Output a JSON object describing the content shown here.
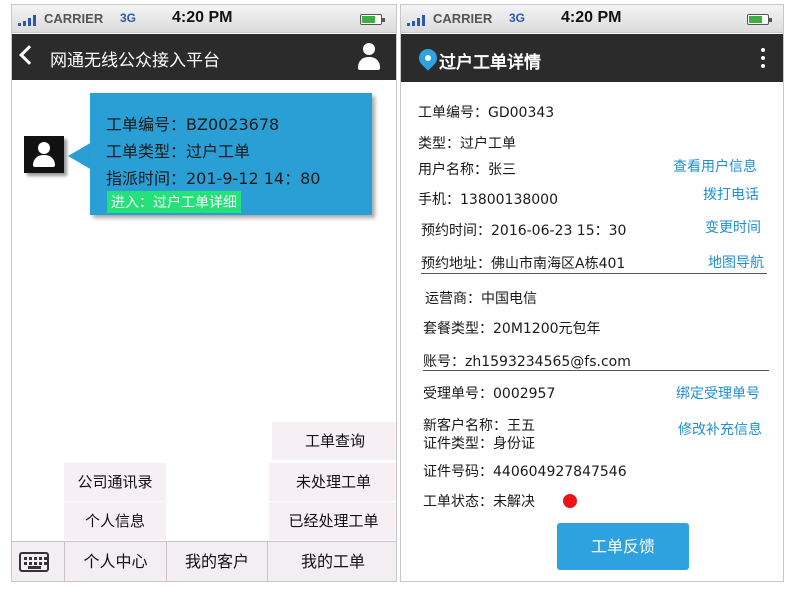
{
  "status_bar": {
    "carrier": "CARRIER",
    "network": "3G",
    "time": "4:20 PM"
  },
  "left": {
    "title": "网通无线公众接入平台",
    "bubble": {
      "order_no": "工单编号：BZ0023678",
      "order_type": "工单类型：过户工单",
      "dispatch_time": "指派时间：201-9-12 14：80",
      "enter_link": "进入：过户工单详细"
    },
    "popup_right": [
      "工单查询",
      "未处理工单",
      "已经处理工单"
    ],
    "popup_left": [
      "公司通讯录",
      "个人信息"
    ],
    "tabs": [
      "个人中心",
      "我的客户",
      "我的工单"
    ]
  },
  "right": {
    "title": "过户工单详情",
    "order_no": "工单编号：GD00343",
    "type": "类型：过户工单",
    "user_name": "用户名称：张三",
    "view_user": "查看用户信息",
    "phone": "手机：13800138000",
    "call": "拨打电话",
    "appointment": "预约时间：2016-06-23 15：30",
    "change_time": "变更时间",
    "address": "预约地址：佛山市南海区A栋401",
    "map_nav": "地图导航",
    "operator": "运营商：中国电信",
    "package": "套餐类型：20M1200元包年",
    "account": "账号：zh1593234565@fs.com",
    "accept_no": "受理单号：0002957",
    "bind_accept": "绑定受理单号",
    "new_customer": "新客户名称：王五",
    "id_type": "证件类型：身份证",
    "modify_info": "修改补充信息",
    "id_no": "证件号码：440604927847546",
    "order_status": "工单状态：未解决",
    "feedback": "工单反馈",
    "status_color": "#e8141a"
  }
}
